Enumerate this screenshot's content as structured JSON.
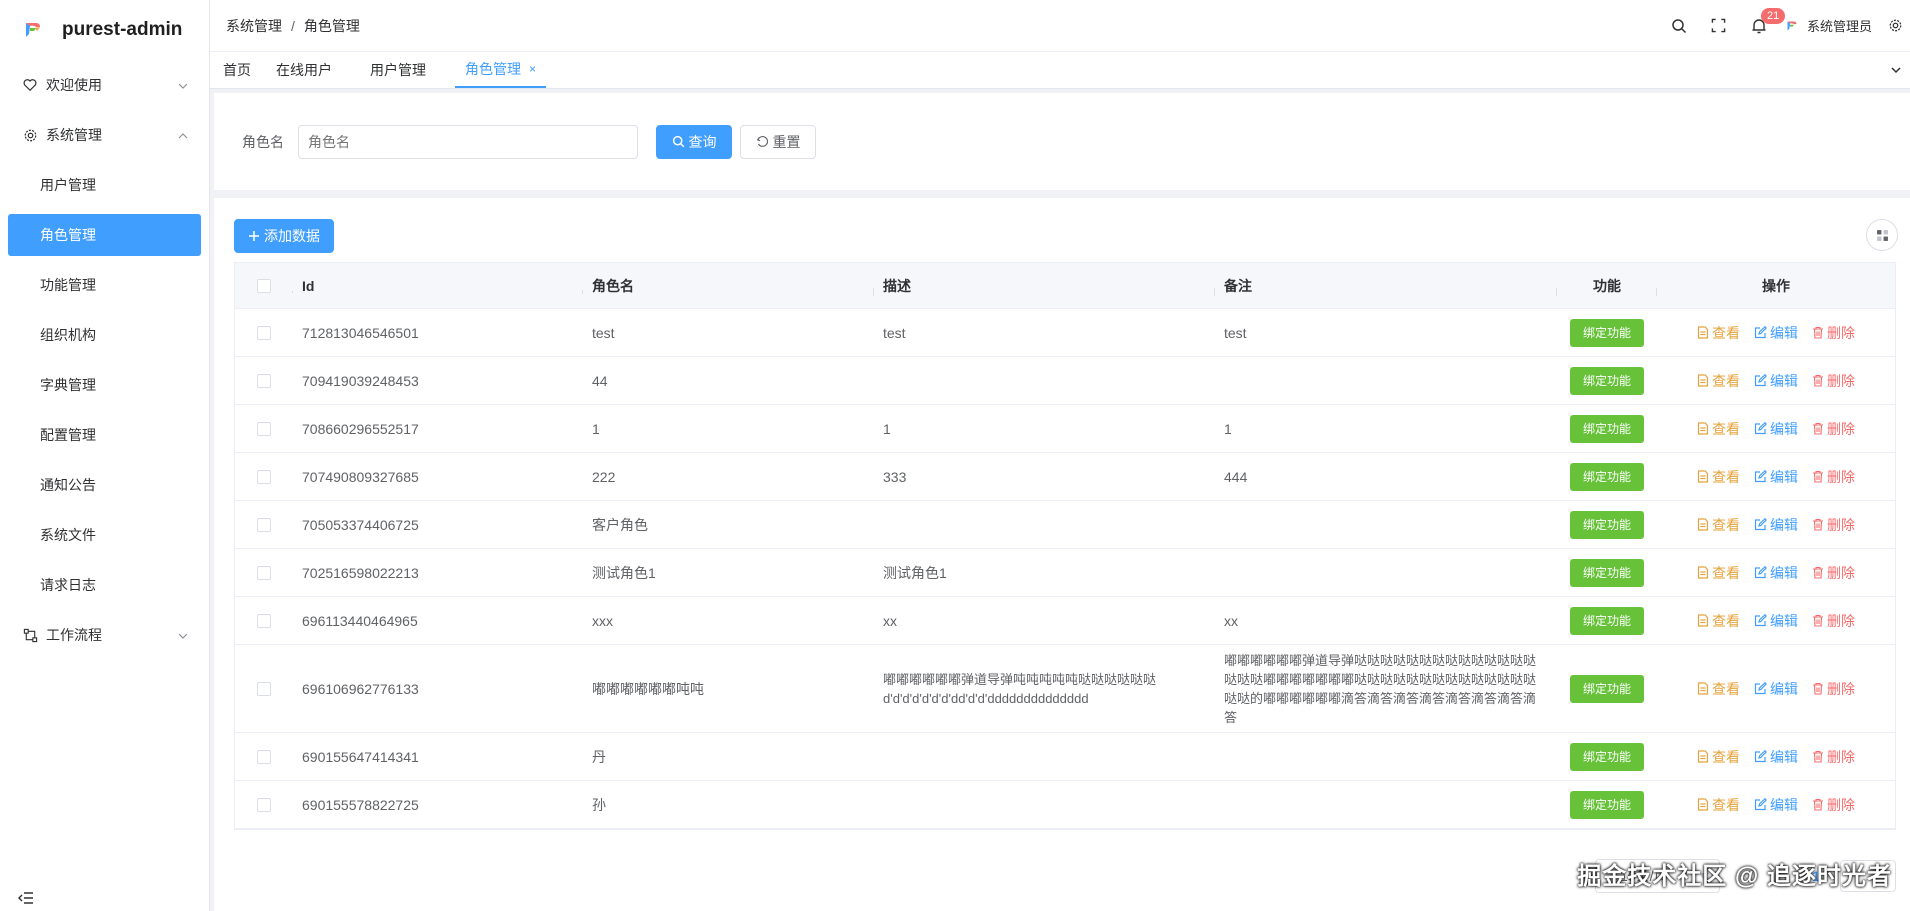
{
  "app": {
    "name": "purest-admin"
  },
  "sidebar": {
    "groups": [
      {
        "label": "欢迎使用",
        "icon": "heart-icon"
      },
      {
        "label": "系统管理",
        "icon": "gear-icon"
      },
      {
        "label": "工作流程",
        "icon": "workflow-icon"
      }
    ],
    "items": [
      {
        "label": "用户管理"
      },
      {
        "label": "角色管理"
      },
      {
        "label": "功能管理"
      },
      {
        "label": "组织机构"
      },
      {
        "label": "字典管理"
      },
      {
        "label": "配置管理"
      },
      {
        "label": "通知公告"
      },
      {
        "label": "系统文件"
      },
      {
        "label": "请求日志"
      }
    ]
  },
  "header": {
    "breadcrumb": [
      "系统管理",
      "角色管理"
    ],
    "notification_count": "21",
    "user": "系统管理员"
  },
  "tabs": [
    {
      "label": "首页"
    },
    {
      "label": "在线用户"
    },
    {
      "label": "用户管理"
    },
    {
      "label": "角色管理",
      "close": "×"
    }
  ],
  "search": {
    "label": "角色名",
    "placeholder": "角色名",
    "search_button": "查询",
    "reset_button": "重置"
  },
  "toolbar": {
    "add_button": "添加数据"
  },
  "table": {
    "columns": [
      "Id",
      "角色名",
      "描述",
      "备注",
      "功能",
      "操作"
    ],
    "bind_label": "绑定功能",
    "action_labels": {
      "view": "查看",
      "edit": "编辑",
      "delete": "删除"
    },
    "rows": [
      {
        "id": "712813046546501",
        "name": "test",
        "desc": "test",
        "remark": "test"
      },
      {
        "id": "709419039248453",
        "name": "44",
        "desc": "",
        "remark": ""
      },
      {
        "id": "708660296552517",
        "name": "1",
        "desc": "1",
        "remark": "1"
      },
      {
        "id": "707490809327685",
        "name": "222",
        "desc": "333",
        "remark": "444"
      },
      {
        "id": "705053374406725",
        "name": "客户角色",
        "desc": "",
        "remark": ""
      },
      {
        "id": "702516598022213",
        "name": "测试角色1",
        "desc": "测试角色1",
        "remark": ""
      },
      {
        "id": "696113440464965",
        "name": "xxx",
        "desc": "xx",
        "remark": "xx"
      },
      {
        "id": "696106962776133",
        "name": "嘟嘟嘟嘟嘟嘟吨吨",
        "desc": "嘟嘟嘟嘟嘟嘟弹道导弹吨吨吨吨吨哒哒哒哒哒哒d'd'd'd'd'd'd'dd'd'd'dddddddddddddd",
        "remark": "嘟嘟嘟嘟嘟嘟弹道导弹哒哒哒哒哒哒哒哒哒哒哒哒哒哒哒哒哒嘟嘟嘟嘟嘟嘟嘟哒哒哒哒哒哒哒哒哒哒哒哒哒哒哒哒的嘟嘟嘟嘟嘟嘟滴答滴答滴答滴答滴答滴答滴答滴答"
      },
      {
        "id": "690155647414341",
        "name": "丹",
        "desc": "",
        "remark": ""
      },
      {
        "id": "690155578822725",
        "name": "孙",
        "desc": "",
        "remark": ""
      }
    ]
  },
  "pagination": {
    "page_size": "10条/页",
    "current_page": "1"
  },
  "watermark": "掘金技术社区 @ 追逐时光者",
  "colors": {
    "primary": "#409eff",
    "success": "#67c23a",
    "warning": "#e6a23c",
    "danger": "#f56c6c"
  }
}
